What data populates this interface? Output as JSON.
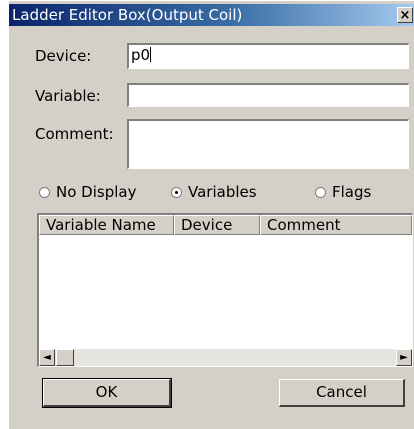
{
  "window": {
    "title": "Ladder Editor Box(Output Coil)",
    "close_glyph": "×"
  },
  "form": {
    "device_label": "Device:",
    "device_value": "p0",
    "variable_label": "Variable:",
    "variable_value": "",
    "comment_label": "Comment:",
    "comment_value": ""
  },
  "display_mode": {
    "options": [
      "No Display",
      "Variables",
      "Flags"
    ],
    "selected": "Variables"
  },
  "list": {
    "columns": [
      "Variable Name",
      "Device",
      "Comment"
    ],
    "rows": []
  },
  "scrollbar": {
    "left_arrow": "◄",
    "right_arrow": "►"
  },
  "buttons": {
    "ok": "OK",
    "cancel": "Cancel"
  }
}
